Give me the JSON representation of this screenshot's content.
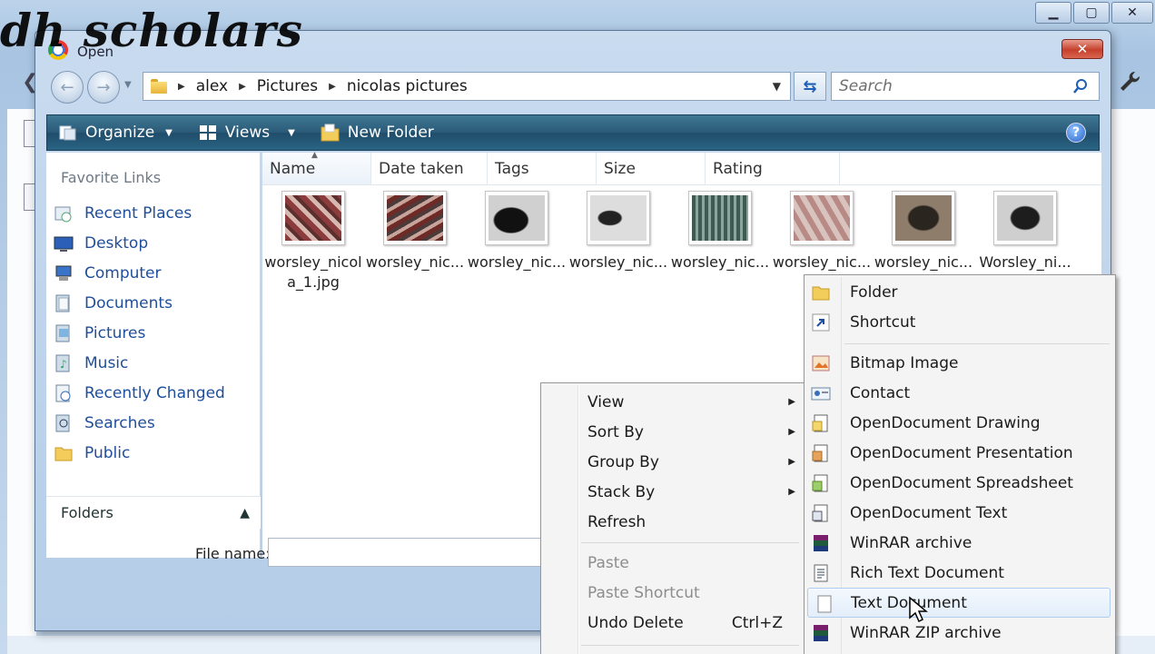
{
  "watermark": "dh scholars",
  "dialog": {
    "title": "Open",
    "close_label": "✕"
  },
  "address": {
    "crumbs": [
      "alex",
      "Pictures",
      "nicolas pictures"
    ]
  },
  "search": {
    "placeholder": "Search"
  },
  "toolbar": {
    "organize": "Organize",
    "views": "Views",
    "new_folder": "New Folder",
    "help": "?"
  },
  "sidebar": {
    "header": "Favorite Links",
    "items": [
      {
        "label": "Recent Places",
        "icon": "recent-places-icon"
      },
      {
        "label": "Desktop",
        "icon": "desktop-icon"
      },
      {
        "label": "Computer",
        "icon": "computer-icon"
      },
      {
        "label": "Documents",
        "icon": "documents-icon"
      },
      {
        "label": "Pictures",
        "icon": "pictures-icon"
      },
      {
        "label": "Music",
        "icon": "music-icon"
      },
      {
        "label": "Recently Changed",
        "icon": "recently-changed-icon"
      },
      {
        "label": "Searches",
        "icon": "searches-icon"
      },
      {
        "label": "Public",
        "icon": "public-folder-icon"
      }
    ],
    "folders_label": "Folders"
  },
  "columns": [
    "Name",
    "Date taken",
    "Tags",
    "Size",
    "Rating"
  ],
  "files": [
    {
      "name": "worsley_nicola_1.jpg"
    },
    {
      "name": "worsley_nic..."
    },
    {
      "name": "worsley_nic..."
    },
    {
      "name": "worsley_nic..."
    },
    {
      "name": "worsley_nic..."
    },
    {
      "name": "worsley_nic..."
    },
    {
      "name": "worsley_nic..."
    },
    {
      "name": "Worsley_ni..."
    }
  ],
  "file_name": {
    "label": "File name:",
    "value": ""
  },
  "context_menu": {
    "items": [
      {
        "label": "View",
        "submenu": true
      },
      {
        "label": "Sort By",
        "submenu": true
      },
      {
        "label": "Group By",
        "submenu": true
      },
      {
        "label": "Stack By",
        "submenu": true
      },
      {
        "label": "Refresh"
      },
      {
        "label": "Paste",
        "disabled": true
      },
      {
        "label": "Paste Shortcut",
        "disabled": true
      },
      {
        "label": "Undo Delete",
        "shortcut": "Ctrl+Z"
      }
    ]
  },
  "new_submenu": {
    "items": [
      {
        "label": "Folder",
        "icon": "folder-icon"
      },
      {
        "label": "Shortcut",
        "icon": "shortcut-icon"
      },
      {
        "label": "Bitmap Image",
        "icon": "bitmap-image-icon"
      },
      {
        "label": "Contact",
        "icon": "contact-icon"
      },
      {
        "label": "OpenDocument Drawing",
        "icon": "odf-drawing-icon"
      },
      {
        "label": "OpenDocument Presentation",
        "icon": "odf-presentation-icon"
      },
      {
        "label": "OpenDocument Spreadsheet",
        "icon": "odf-spreadsheet-icon"
      },
      {
        "label": "OpenDocument Text",
        "icon": "odf-text-icon"
      },
      {
        "label": "WinRAR archive",
        "icon": "winrar-icon"
      },
      {
        "label": "Rich Text Document",
        "icon": "rich-text-icon"
      },
      {
        "label": "Text Document",
        "icon": "text-document-icon",
        "highlighted": true
      },
      {
        "label": "WinRAR ZIP archive",
        "icon": "winrar-zip-icon"
      }
    ]
  },
  "colors": {
    "toolbar": "#2a5a78",
    "link": "#1f4e9a",
    "highlight_border": "#aecdf0"
  }
}
